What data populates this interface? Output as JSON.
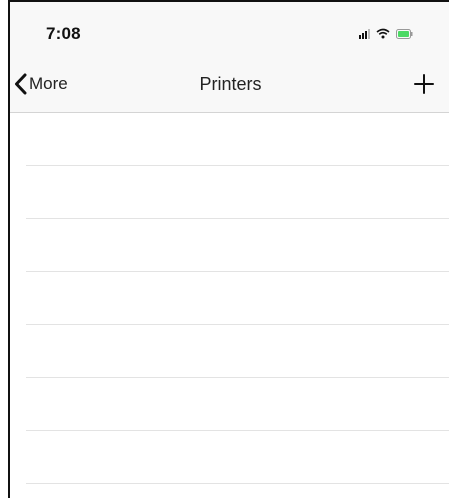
{
  "status_bar": {
    "time": "7:08",
    "icons": [
      "signal-icon",
      "wifi-icon",
      "battery-icon"
    ],
    "battery_color": "#4cd964"
  },
  "nav": {
    "back_label": "More",
    "back_icon": "chevron-left-icon",
    "title": "Printers",
    "add_icon": "plus-icon"
  },
  "printers_list": {
    "items": []
  },
  "colors": {
    "bar_background": "#f8f8f8",
    "separator": "#e3e3e3",
    "text": "#222222"
  }
}
